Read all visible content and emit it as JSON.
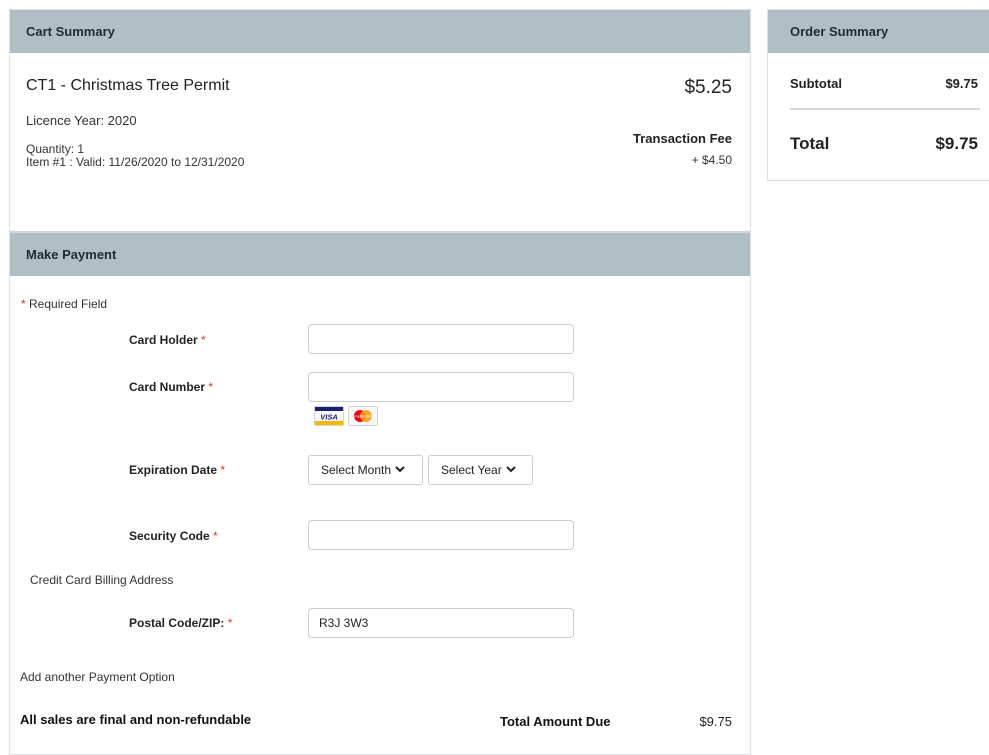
{
  "cart": {
    "header": "Cart Summary",
    "item_title": "CT1 - Christmas Tree Permit",
    "item_price": "$5.25",
    "licence_year": "Licence Year: 2020",
    "quantity": "Quantity: 1",
    "item_validity": "Item #1 : Valid: 11/26/2020 to 12/31/2020",
    "fee_label": "Transaction Fee",
    "fee_value": "+ $4.50"
  },
  "payment": {
    "header": "Make Payment",
    "required_note": "Required Field",
    "required_marker": "*",
    "card_holder": {
      "label": "Card Holder",
      "value": ""
    },
    "card_number": {
      "label": "Card Number",
      "value": ""
    },
    "card_logos": [
      "VISA",
      "mastercard"
    ],
    "expiration": {
      "label": "Expiration Date",
      "month": "Select Month",
      "year": "Select Year"
    },
    "security_code": {
      "label": "Security Code",
      "value": ""
    },
    "billing_heading": "Credit Card Billing Address",
    "postal": {
      "label": "Postal Code/ZIP:",
      "value": "R3J 3W3"
    },
    "add_option": "Add another Payment Option",
    "final_note": "All sales are final and non-refundable",
    "total_label": "Total Amount Due",
    "total_value": "$9.75"
  },
  "order": {
    "header": "Order Summary",
    "subtotal_label": "Subtotal",
    "subtotal_value": "$9.75",
    "total_label": "Total",
    "total_value": "$9.75"
  },
  "colors": {
    "header_bg": "#b0bfc6",
    "required_star": "#dd3333",
    "visa_blue": "#1a1f71",
    "mastercard_red": "#eb001b",
    "mastercard_orange": "#f79e1b"
  }
}
